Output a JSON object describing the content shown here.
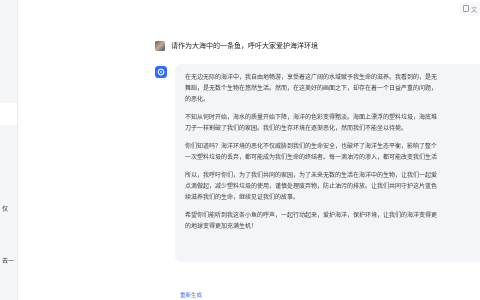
{
  "sidebar": {
    "fragment_1": "仅",
    "fragment_2": "去一"
  },
  "topbar": {
    "doc_label": "文"
  },
  "chat": {
    "user_message": "请作为大海中的一条鱼，呼吁大家爱护海洋环境",
    "reply_paragraphs": [
      "在无边无际的海洋中，我自由地畅游，享受着这广阔的水域赋予我生命的滋养。我看到的，是无\n舞蹈，是无数个生物在悠然生活。然而，在这美好的画面之下，却存在着一个日益严重的问题，\n的恶化。",
      "不知从何时开始，海水的质量开始下降，海洋的色彩变得黯淡。海面上漂浮的塑料垃圾，海底堆\n刀子一样割破了我们的家园。我们的生存环境在逐渐恶化，然而我们不能坐以待毙。",
      "你们知道吗？海洋环境的恶化不仅威胁到我们的生命安全，也破坏了海洋生态平衡，影响了整个\n一次塑料垃圾的丢弃，都可能成为我们生命的终结者。每一滴油污的渗入，都可能改变我们生活",
      "所以，我呼吁你们，为了我们共同的家园，为了未来无数的生活在海洋中的生物，让我们一起爱\n点滴做起，减少塑料垃圾的使用，谨慎处理废弃物，防止油污的排放。让我们共同守护这片蓝色\n续滋养我们的生命，继续见证我们的故事。",
      "希望你们能听到我这条小鱼的呼声，一起行动起来，爱护海洋，保护环境，让我们的海洋变得更\n的地球变得更加充满生机！"
    ],
    "regenerate_label": "重新生成"
  }
}
